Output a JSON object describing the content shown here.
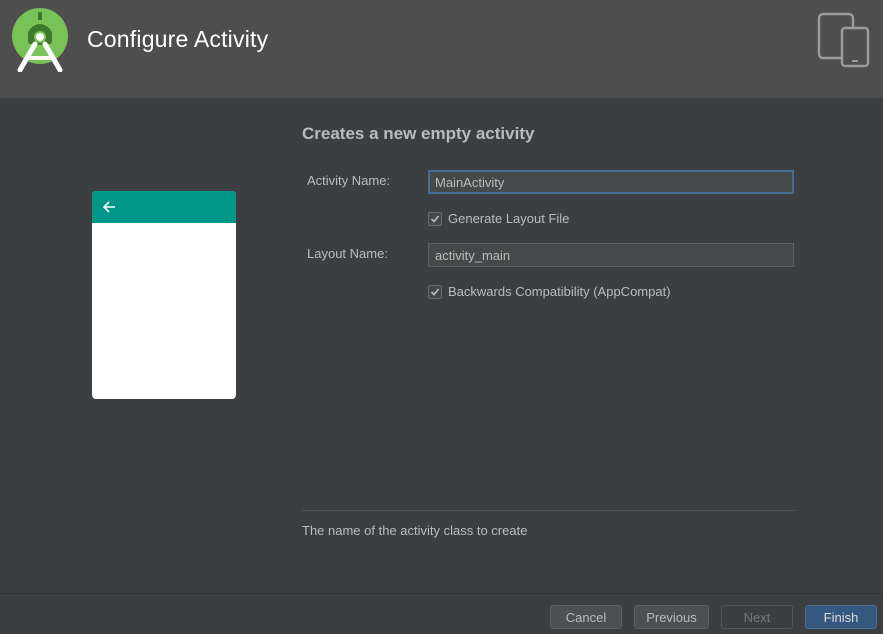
{
  "window": {
    "title": "Configure Activity",
    "logo_icon": "android-studio-logo",
    "device_icon": "tablet-phone-icon"
  },
  "preview": {
    "bar_color": "#009688",
    "back_icon": "arrow-left-icon"
  },
  "form": {
    "title": "Creates a new empty activity",
    "activity_name_label": "Activity Name:",
    "activity_name_value": "MainActivity",
    "generate_layout_label": "Generate Layout File",
    "generate_layout_checked": true,
    "layout_name_label": "Layout Name:",
    "layout_name_value": "activity_main",
    "backwards_compat_label": "Backwards Compatibility (AppCompat)",
    "backwards_compat_checked": true,
    "hint": "The name of the activity class to create"
  },
  "footer": {
    "cancel_label": "Cancel",
    "previous_label": "Previous",
    "next_label": "Next",
    "finish_label": "Finish"
  },
  "colors": {
    "accent": "#365880",
    "focus_border": "#466d94",
    "android_green": "#78c257"
  }
}
